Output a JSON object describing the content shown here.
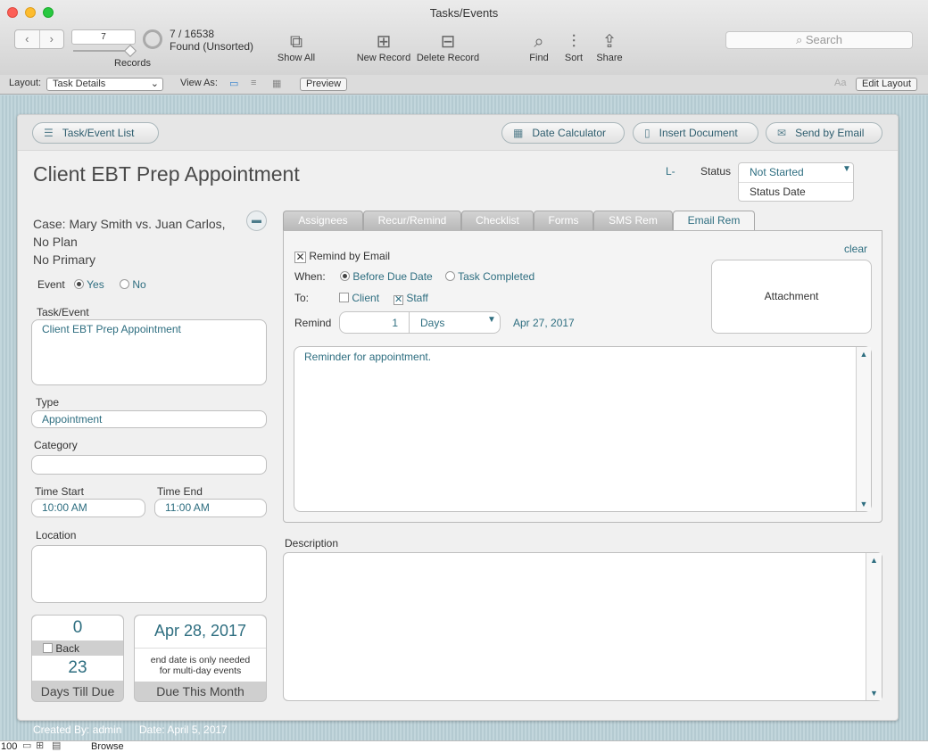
{
  "window": {
    "title": "Tasks/Events"
  },
  "toolbar": {
    "record_number": "7",
    "found_count": "7 / 16538",
    "found_status": "Found (Unsorted)",
    "records_label": "Records",
    "show_all": "Show All",
    "new_record": "New Record",
    "delete_record": "Delete Record",
    "find": "Find",
    "sort": "Sort",
    "share": "Share",
    "search_placeholder": "Search"
  },
  "layout_bar": {
    "layout_label": "Layout:",
    "layout_value": "Task Details",
    "view_as_label": "View As:",
    "preview": "Preview",
    "font_glyph": "Aa",
    "edit_layout": "Edit Layout"
  },
  "header_buttons": {
    "list": "Task/Event List",
    "date_calc": "Date Calculator",
    "insert_doc": "Insert Document",
    "send_email": "Send by Email"
  },
  "record": {
    "title": "Client EBT Prep Appointment",
    "l_marker": "L-",
    "status_label": "Status",
    "status_value": "Not Started",
    "status_date_label": "Status Date",
    "case_line1": "Case: Mary Smith vs. Juan Carlos,",
    "case_line2": "No Plan",
    "case_line3": "No Primary",
    "event_label": "Event",
    "event_yes": "Yes",
    "event_no": "No",
    "task_event_label": "Task/Event",
    "task_event_value": "Client EBT Prep Appointment",
    "type_label": "Type",
    "type_value": "Appointment",
    "category_label": "Category",
    "category_value": "",
    "time_start_label": "Time Start",
    "time_start_value": "10:00 AM",
    "time_end_label": "Time End",
    "time_end_value": "11:00 AM",
    "location_label": "Location",
    "location_value": "",
    "days_count": "0",
    "back_label": "Back",
    "days_total": "23",
    "days_till_due_label": "Days Till Due",
    "due_date": "Apr 28, 2017",
    "end_date_note_1": "end date is only needed",
    "end_date_note_2": "for multi-day events",
    "due_this_month_label": "Due This Month",
    "description_label": "Description",
    "description_value": ""
  },
  "tabs": [
    "Assignees",
    "Recur/Remind",
    "Checklist",
    "Forms",
    "SMS Rem",
    "Email Rem"
  ],
  "email_rem": {
    "remind_by_email": "Remind by Email",
    "clear": "clear",
    "when_label": "When:",
    "before_due": "Before Due Date",
    "task_completed": "Task Completed",
    "to_label": "To:",
    "client": "Client",
    "staff": "Staff",
    "remind_label": "Remind",
    "remind_number": "1",
    "remind_unit": "Days",
    "remind_date": "Apr 27, 2017",
    "attachment": "Attachment",
    "message": "Reminder for appointment."
  },
  "footer": {
    "created_by": "Created By: admin",
    "date": "Date: April 5, 2017"
  },
  "statusbar": {
    "zoom": "100",
    "mode": "Browse"
  },
  "colors": {
    "accent": "#2e6e80",
    "background": "#c5d8de"
  }
}
